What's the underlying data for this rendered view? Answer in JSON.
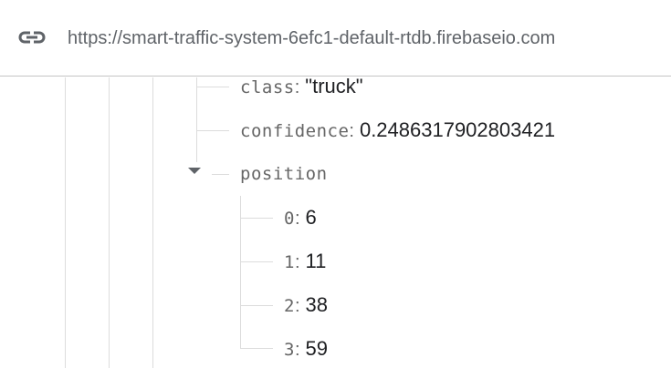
{
  "header": {
    "url": "https://smart-traffic-system-6efc1-default-rtdb.firebaseio.com",
    "link_icon": "link-icon"
  },
  "tree": {
    "class": {
      "key": "class",
      "value": "\"truck\""
    },
    "confidence": {
      "key": "confidence",
      "value": "0.2486317902803421"
    },
    "position": {
      "key": "position",
      "items": [
        {
          "key": "0",
          "value": "6"
        },
        {
          "key": "1",
          "value": "11"
        },
        {
          "key": "2",
          "value": "38"
        },
        {
          "key": "3",
          "value": "59"
        }
      ]
    }
  }
}
